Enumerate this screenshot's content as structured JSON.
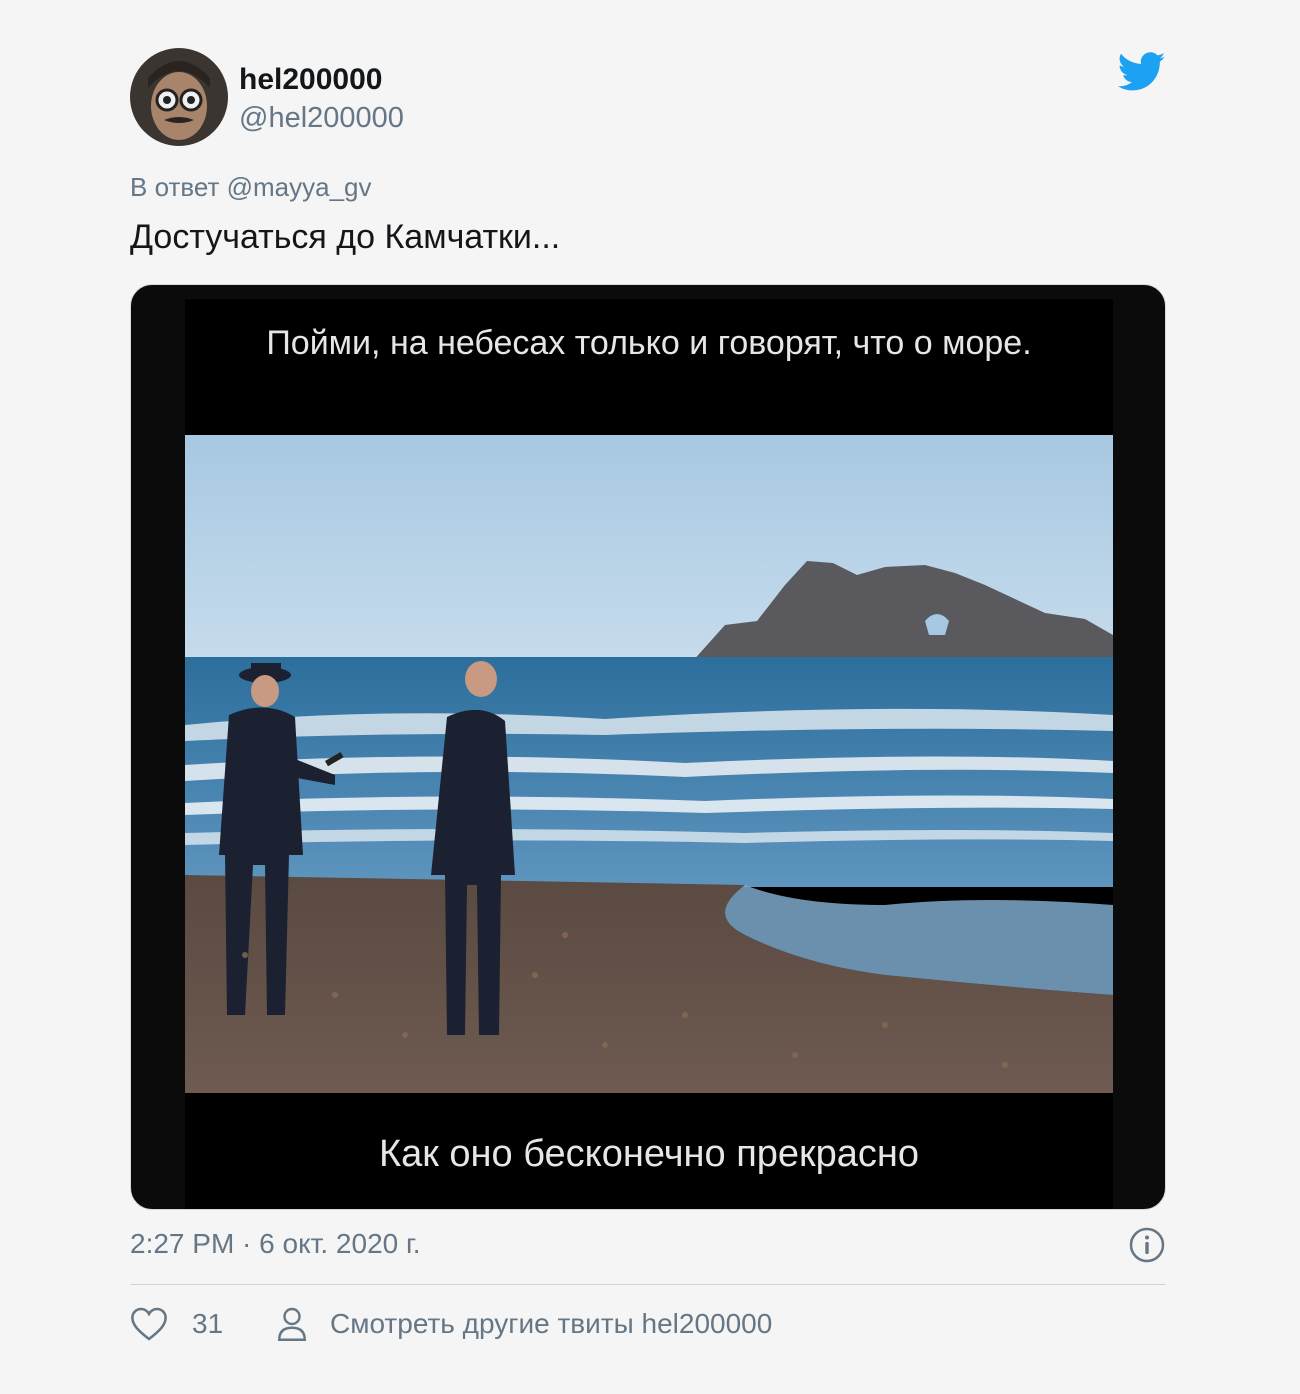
{
  "author": {
    "name": "hel200000",
    "handle": "@hel200000"
  },
  "reply": {
    "prefix": "В ответ ",
    "mention": "@mayya_gv"
  },
  "tweet": {
    "text": "Достучаться до Камчатки..."
  },
  "media": {
    "caption_top": "Пойми, на небесах только и говорят, что о море.",
    "caption_bottom": "Как оно бесконечно прекрасно"
  },
  "meta": {
    "timestamp": "2:27 PM · 6 окт. 2020 г."
  },
  "actions": {
    "like_count": "31",
    "more_tweets_label": "Смотреть другие твиты hel200000"
  },
  "colors": {
    "twitter_blue": "#1da1f2",
    "secondary_text": "#657786",
    "primary_text": "#14171a"
  },
  "icons": [
    "twitter-bird-icon",
    "info-icon",
    "heart-icon",
    "person-icon"
  ]
}
